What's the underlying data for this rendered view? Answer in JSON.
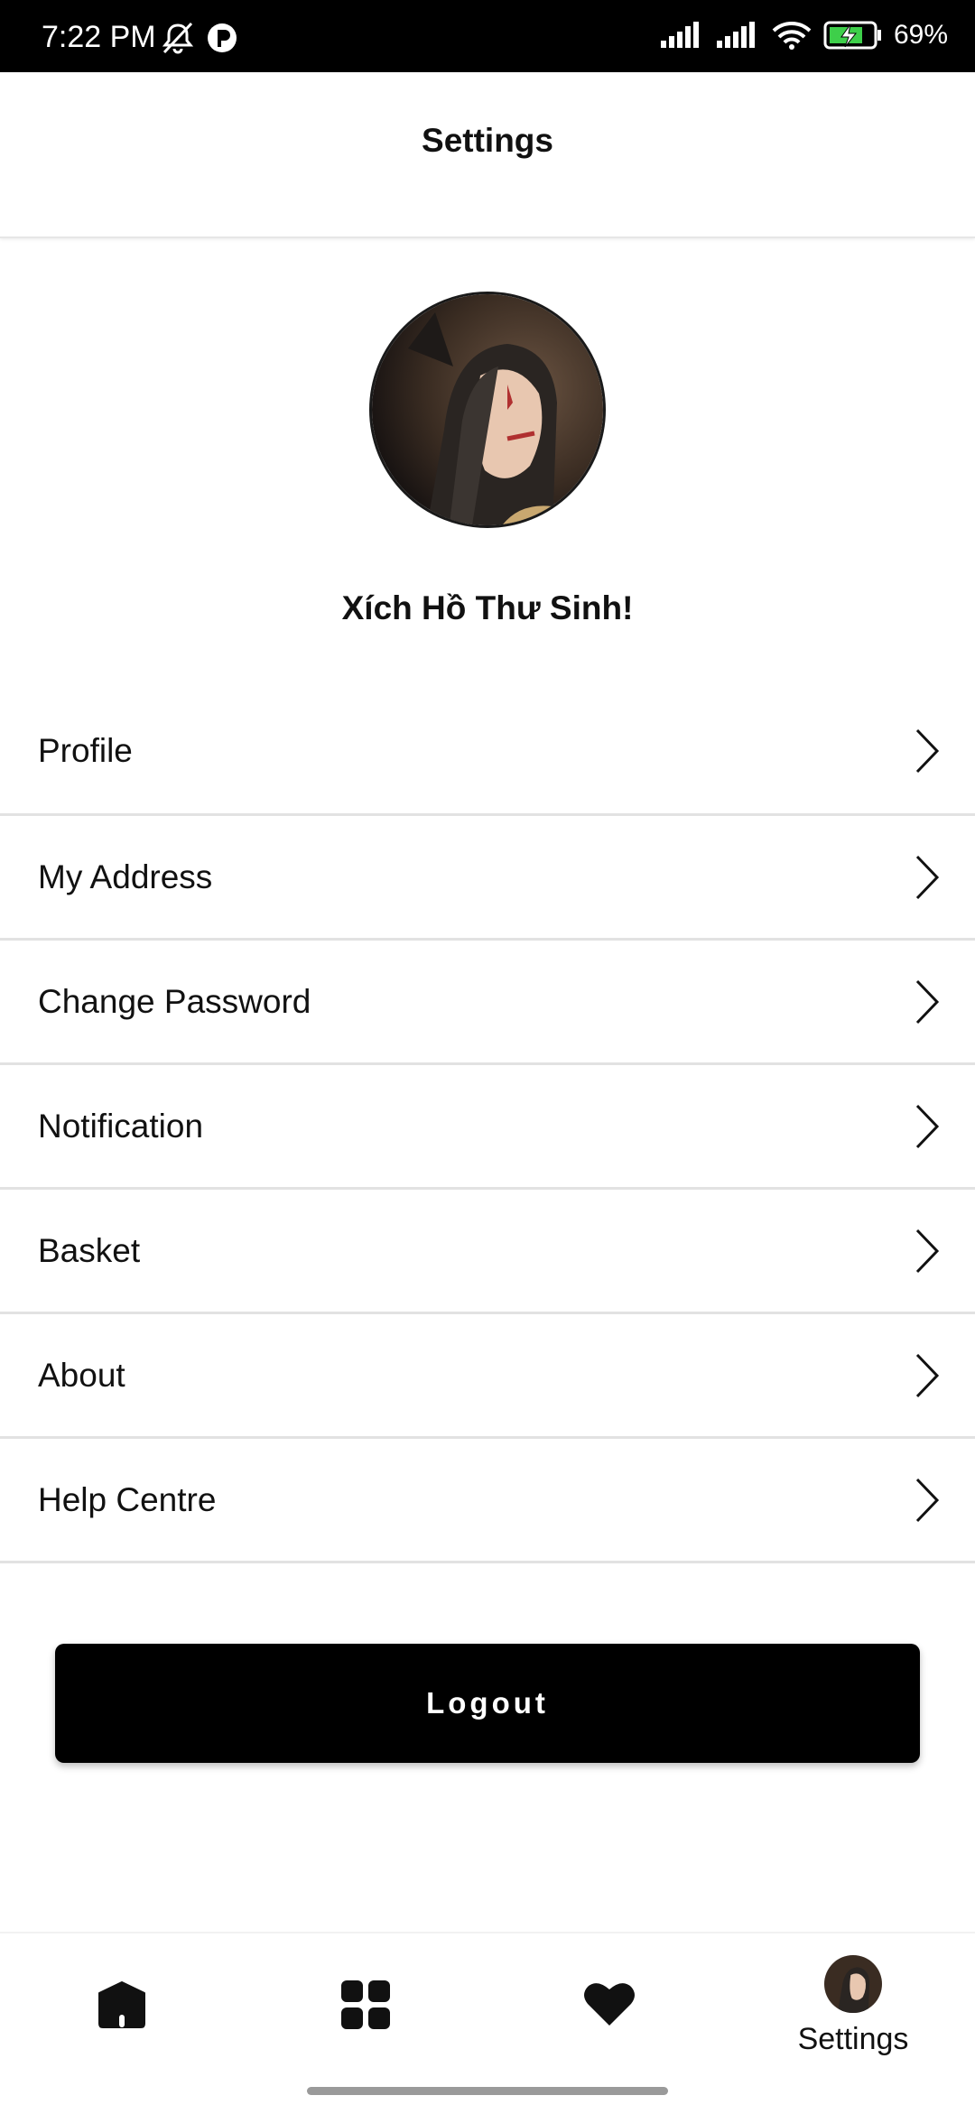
{
  "status_bar": {
    "time": "7:22 PM",
    "battery": "69%",
    "icons": [
      "bell-off-icon",
      "p-app-icon",
      "signal-icon",
      "signal-icon",
      "wifi-icon",
      "battery-charging-icon"
    ]
  },
  "header": {
    "title": "Settings"
  },
  "profile": {
    "name": "Xích Hồ Thư Sinh!",
    "avatar_icon": "avatar"
  },
  "menu": {
    "items": [
      {
        "label": "Profile"
      },
      {
        "label": "My Address"
      },
      {
        "label": "Change Password"
      },
      {
        "label": "Notification"
      },
      {
        "label": "Basket"
      },
      {
        "label": "About"
      },
      {
        "label": "Help Centre"
      }
    ]
  },
  "logout": {
    "label": "Logout"
  },
  "bottom_nav": {
    "items": [
      {
        "icon": "home-icon"
      },
      {
        "icon": "grid-icon"
      },
      {
        "icon": "heart-icon"
      },
      {
        "icon": "avatar",
        "label": "Settings"
      }
    ]
  },
  "colors": {
    "primary": "#000000",
    "background": "#ffffff",
    "divider": "#e2e2e2"
  }
}
